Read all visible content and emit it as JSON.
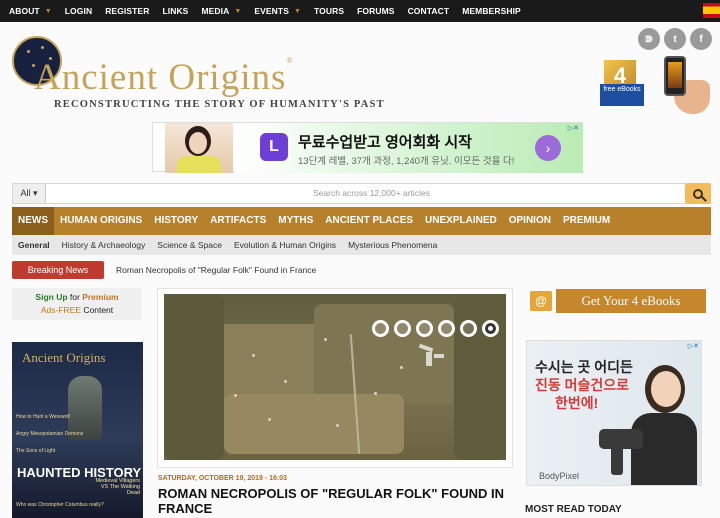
{
  "topbar": {
    "items": [
      {
        "label": "ABOUT",
        "has_menu": true
      },
      {
        "label": "LOGIN",
        "has_menu": false
      },
      {
        "label": "REGISTER",
        "has_menu": false
      },
      {
        "label": "LINKS",
        "has_menu": false
      },
      {
        "label": "MEDIA",
        "has_menu": true
      },
      {
        "label": "EVENTS",
        "has_menu": true
      },
      {
        "label": "TOURS",
        "has_menu": false
      },
      {
        "label": "FORUMS",
        "has_menu": false
      },
      {
        "label": "CONTACT",
        "has_menu": false
      },
      {
        "label": "MEMBERSHIP",
        "has_menu": false
      }
    ]
  },
  "header": {
    "logo_text": "Ancient Origins",
    "logo_reg": "®",
    "tagline": "Reconstructing the story of humanity's past",
    "social_icons": [
      "rss-icon",
      "twitter-icon",
      "facebook-icon"
    ],
    "ebook_badge_number": "4",
    "ebook_badge_text": "free eBooks"
  },
  "ad_top": {
    "logo_letter": "L",
    "headline": "무료수업받고 영어회화 시작",
    "subline": "13단계 레벨, 37개 과정, 1,240개 유닛. 이모든 것을 다!",
    "arrow": "›"
  },
  "search": {
    "scope": "All",
    "placeholder": "Search across 12,000+ articles"
  },
  "main_nav": [
    {
      "label": "NEWS",
      "active": true
    },
    {
      "label": "HUMAN ORIGINS",
      "active": false
    },
    {
      "label": "HISTORY",
      "active": false
    },
    {
      "label": "ARTIFACTS",
      "active": false
    },
    {
      "label": "MYTHS",
      "active": false
    },
    {
      "label": "ANCIENT PLACES",
      "active": false
    },
    {
      "label": "UNEXPLAINED",
      "active": false
    },
    {
      "label": "OPINION",
      "active": false
    },
    {
      "label": "PREMIUM",
      "active": false
    }
  ],
  "sub_nav": [
    {
      "label": "General"
    },
    {
      "label": "History & Archaeology"
    },
    {
      "label": "Science & Space"
    },
    {
      "label": "Evolution & Human Origins"
    },
    {
      "label": "Mysterious Phenomena"
    }
  ],
  "breaking": {
    "label": "Breaking News",
    "text": "Roman Necropolis of \"Regular Folk\" Found in France"
  },
  "signup": {
    "sign_up": "Sign Up",
    "for": "for",
    "premium": "Premium",
    "ads_free": "Ads-FREE",
    "content": "Content"
  },
  "magazine": {
    "title": "Ancient Origins",
    "headlines": [
      "How to Hunt a Werewolf",
      "Angry Mesopotamian Demons",
      "The Sons of Light",
      "Who was Christopher Columbus really?"
    ],
    "cover_big": "HAUNTED HISTORY",
    "cover_side": "Medieval Villagers VS The Walking Dead"
  },
  "article": {
    "slides": 6,
    "active_slide": 6,
    "date": "SATURDAY, OCTOBER 19, 2019 - 16:03",
    "title": "ROMAN NECROPOLIS OF \"REGULAR FOLK\" FOUND IN FRANCE"
  },
  "sidebar": {
    "ebook_banner": "Get Your 4 eBooks",
    "ebook_icon": "@",
    "ad": {
      "line1": "수시는 곳 어디든",
      "line2": "진동 머슬건으로",
      "line3": "한번에!",
      "brand": "BodyPixel"
    },
    "most_read": "MOST READ TODAY"
  },
  "colors": {
    "nav_gold": "#b7802b",
    "breaking_red": "#bf3b2f",
    "dark_bar": "#1a1a1a"
  }
}
